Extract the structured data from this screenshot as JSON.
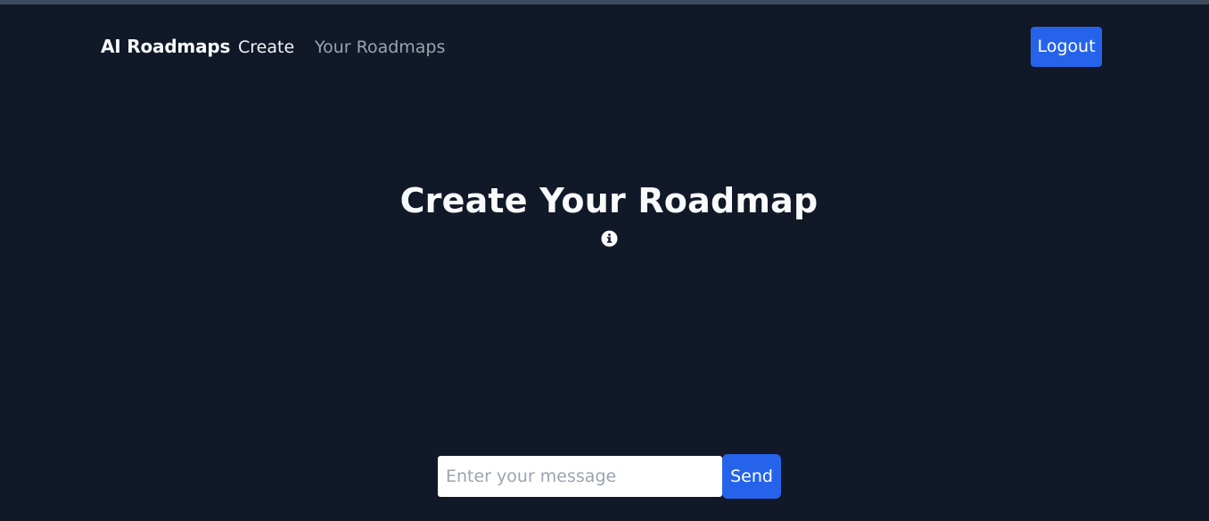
{
  "navbar": {
    "brand": "AI Roadmaps",
    "links": [
      {
        "label": "Create",
        "active": true
      },
      {
        "label": "Your Roadmaps",
        "active": false
      }
    ],
    "logout_label": "Logout"
  },
  "main": {
    "title": "Create Your Roadmap",
    "info_icon": "info-circle-icon"
  },
  "composer": {
    "placeholder": "Enter your message",
    "value": "",
    "send_label": "Send"
  },
  "colors": {
    "background": "#111827",
    "accent": "#2563eb",
    "text_primary": "#f9fafb",
    "text_muted": "#9ca3af"
  }
}
